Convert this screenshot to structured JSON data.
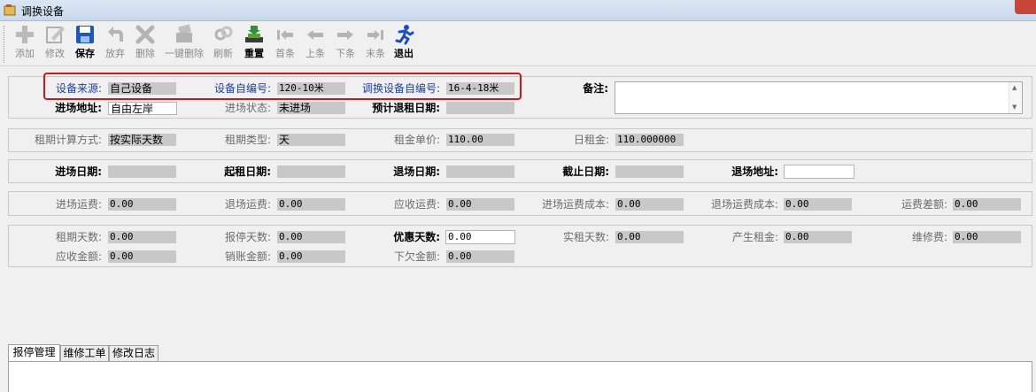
{
  "window": {
    "title": "调换设备"
  },
  "toolbar": {
    "buttons": [
      {
        "label": "添加",
        "icon": "plus-icon",
        "enabled": false
      },
      {
        "label": "修改",
        "icon": "edit-icon",
        "enabled": false
      },
      {
        "label": "保存",
        "icon": "save-icon",
        "enabled": true
      },
      {
        "label": "放弃",
        "icon": "undo-icon",
        "enabled": false
      },
      {
        "label": "删除",
        "icon": "delete-icon",
        "enabled": false
      },
      {
        "label": "一键删除",
        "icon": "bulk-delete-icon",
        "enabled": false
      },
      {
        "label": "刷新",
        "icon": "refresh-icon",
        "enabled": false
      },
      {
        "label": "重置",
        "icon": "reset-icon",
        "enabled": true
      },
      {
        "label": "首条",
        "icon": "first-record-icon",
        "enabled": false
      },
      {
        "label": "上条",
        "icon": "previous-record-icon",
        "enabled": false
      },
      {
        "label": "下条",
        "icon": "next-record-icon",
        "enabled": false
      },
      {
        "label": "末条",
        "icon": "last-record-icon",
        "enabled": false
      },
      {
        "label": "退出",
        "icon": "exit-runner-icon",
        "enabled": true
      }
    ]
  },
  "equipment": {
    "source_label": "设备来源:",
    "source_value": "自己设备",
    "self_no_label": "设备自编号:",
    "self_no_value": "120-10米",
    "swap_no_label": "调换设备自编号:",
    "swap_no_value": "16-4-18米",
    "remarks_label": "备注:",
    "remarks_value": "",
    "entry_address_label": "进场地址:",
    "entry_address_value": "自由左岸",
    "entry_status_label": "进场状态:",
    "entry_status_value": "未进场",
    "planned_return_label": "预计退租日期:",
    "planned_return_value": ""
  },
  "rent": {
    "calc_method_label": "租期计算方式:",
    "calc_method_value": "按实际天数",
    "period_type_label": "租期类型:",
    "period_type_value": "天",
    "unit_price_label": "租金单价:",
    "unit_price_value": "110.00",
    "daily_rent_label": "日租金:",
    "daily_rent_value": "110.000000"
  },
  "dates": {
    "entry_date_label": "进场日期:",
    "entry_date_value": "",
    "start_date_label": "起租日期:",
    "start_date_value": "",
    "exit_date_label": "退场日期:",
    "exit_date_value": "",
    "end_date_label": "截止日期:",
    "end_date_value": "",
    "exit_address_label": "退场地址:",
    "exit_address_value": ""
  },
  "freight": {
    "entry_freight_label": "进场运费:",
    "entry_freight_value": "0.00",
    "exit_freight_label": "退场运费:",
    "exit_freight_value": "0.00",
    "receivable_freight_label": "应收运费:",
    "receivable_freight_value": "0.00",
    "entry_cost_label": "进场运费成本:",
    "entry_cost_value": "0.00",
    "exit_cost_label": "退场运费成本:",
    "exit_cost_value": "0.00",
    "diff_label": "运费差额:",
    "diff_value": "0.00"
  },
  "totals": {
    "rent_days_label": "租期天数:",
    "rent_days_value": "0.00",
    "stop_days_label": "报停天数:",
    "stop_days_value": "0.00",
    "discount_days_label": "优惠天数:",
    "discount_days_value": "0.00",
    "actual_days_label": "实租天数:",
    "actual_days_value": "0.00",
    "rent_generated_label": "产生租金:",
    "rent_generated_value": "0.00",
    "repair_fee_label": "维修费:",
    "repair_fee_value": "0.00",
    "receivable_label": "应收金额:",
    "receivable_value": "0.00",
    "writeoff_label": "销账金额:",
    "writeoff_value": "0.00",
    "owed_label": "下欠金额:",
    "owed_value": "0.00"
  },
  "tabs": [
    {
      "label": "报停管理",
      "active": true
    },
    {
      "label": "维修工单",
      "active": false
    },
    {
      "label": "修改日志",
      "active": false
    }
  ],
  "colors": {
    "highlight_box": "#d0161a",
    "label_blue": "#1f3f9e",
    "readonly_field": "#c8c8c8"
  }
}
